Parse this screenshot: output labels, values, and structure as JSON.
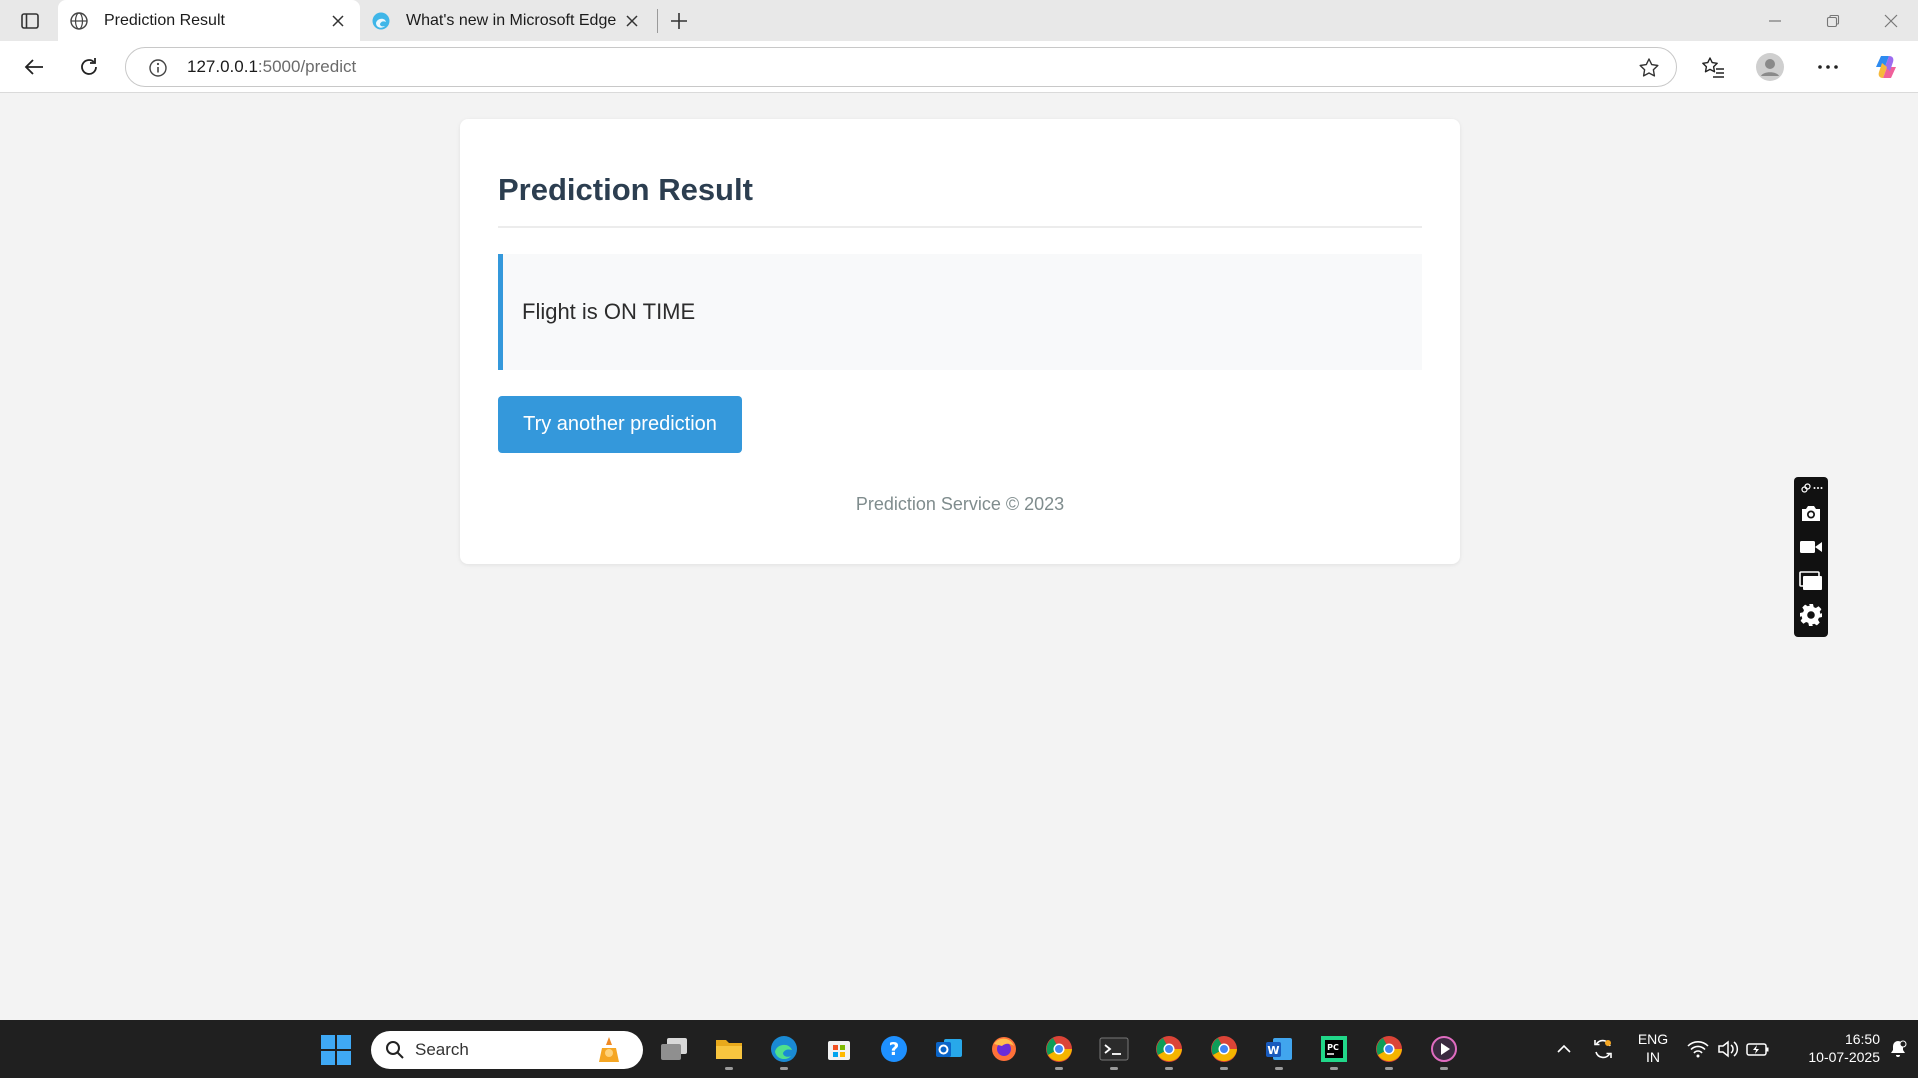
{
  "browser": {
    "tabs": [
      {
        "title": "Prediction Result",
        "active": true
      },
      {
        "title": "What's new in Microsoft Edge",
        "active": false
      }
    ],
    "address": {
      "host": "127.0.0.1",
      "path": ":5000/predict"
    }
  },
  "page": {
    "title": "Prediction Result",
    "result_text": "Flight is ON TIME",
    "button_label": "Try another prediction",
    "footer": "Prediction Service © 2023"
  },
  "taskbar": {
    "search_label": "Search",
    "lang_line1": "ENG",
    "lang_line2": "IN",
    "time": "16:50",
    "date": "10-07-2025"
  },
  "colors": {
    "accent": "#3498db",
    "heading": "#2c3e50",
    "footer_text": "#7f8c8d",
    "background": "#f3f3f3"
  }
}
